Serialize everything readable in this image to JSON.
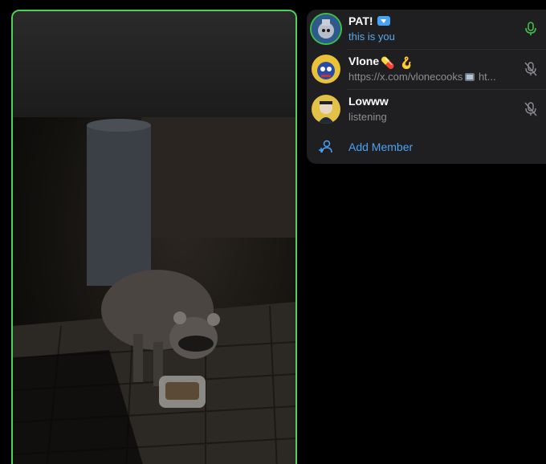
{
  "participants": [
    {
      "name": "PAT!",
      "status": "this is you",
      "avatar": "robot-avatar",
      "mic": "mic-on",
      "is_self": true,
      "badge": "premium-badge-icon"
    },
    {
      "name": "Vlone",
      "status": "https://x.com/vlonecooks",
      "status_suffix": " ht...",
      "avatar": "cartoon-avatar",
      "mic": "mic-muted",
      "emoji": "💊",
      "emoji2": "🪝"
    },
    {
      "name": "Lowww",
      "status": "listening",
      "avatar": "character-avatar",
      "mic": "mic-muted"
    }
  ],
  "add_member": {
    "label": "Add Member"
  },
  "colors": {
    "speaking": "#4fd05a",
    "link": "#4aa3f2",
    "panel": "#1f1f21"
  }
}
